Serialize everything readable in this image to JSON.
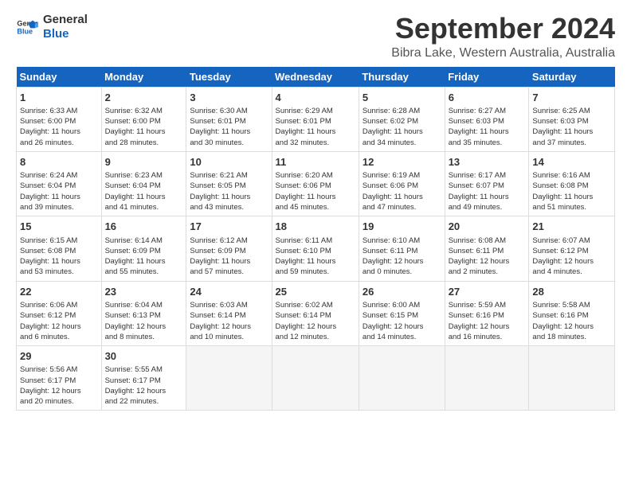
{
  "logo": {
    "line1": "General",
    "line2": "Blue"
  },
  "title": "September 2024",
  "subtitle": "Bibra Lake, Western Australia, Australia",
  "weekdays": [
    "Sunday",
    "Monday",
    "Tuesday",
    "Wednesday",
    "Thursday",
    "Friday",
    "Saturday"
  ],
  "weeks": [
    [
      {
        "day": "1",
        "lines": [
          "Sunrise: 6:33 AM",
          "Sunset: 6:00 PM",
          "Daylight: 11 hours",
          "and 26 minutes."
        ]
      },
      {
        "day": "2",
        "lines": [
          "Sunrise: 6:32 AM",
          "Sunset: 6:00 PM",
          "Daylight: 11 hours",
          "and 28 minutes."
        ]
      },
      {
        "day": "3",
        "lines": [
          "Sunrise: 6:30 AM",
          "Sunset: 6:01 PM",
          "Daylight: 11 hours",
          "and 30 minutes."
        ]
      },
      {
        "day": "4",
        "lines": [
          "Sunrise: 6:29 AM",
          "Sunset: 6:01 PM",
          "Daylight: 11 hours",
          "and 32 minutes."
        ]
      },
      {
        "day": "5",
        "lines": [
          "Sunrise: 6:28 AM",
          "Sunset: 6:02 PM",
          "Daylight: 11 hours",
          "and 34 minutes."
        ]
      },
      {
        "day": "6",
        "lines": [
          "Sunrise: 6:27 AM",
          "Sunset: 6:03 PM",
          "Daylight: 11 hours",
          "and 35 minutes."
        ]
      },
      {
        "day": "7",
        "lines": [
          "Sunrise: 6:25 AM",
          "Sunset: 6:03 PM",
          "Daylight: 11 hours",
          "and 37 minutes."
        ]
      }
    ],
    [
      {
        "day": "8",
        "lines": [
          "Sunrise: 6:24 AM",
          "Sunset: 6:04 PM",
          "Daylight: 11 hours",
          "and 39 minutes."
        ]
      },
      {
        "day": "9",
        "lines": [
          "Sunrise: 6:23 AM",
          "Sunset: 6:04 PM",
          "Daylight: 11 hours",
          "and 41 minutes."
        ]
      },
      {
        "day": "10",
        "lines": [
          "Sunrise: 6:21 AM",
          "Sunset: 6:05 PM",
          "Daylight: 11 hours",
          "and 43 minutes."
        ]
      },
      {
        "day": "11",
        "lines": [
          "Sunrise: 6:20 AM",
          "Sunset: 6:06 PM",
          "Daylight: 11 hours",
          "and 45 minutes."
        ]
      },
      {
        "day": "12",
        "lines": [
          "Sunrise: 6:19 AM",
          "Sunset: 6:06 PM",
          "Daylight: 11 hours",
          "and 47 minutes."
        ]
      },
      {
        "day": "13",
        "lines": [
          "Sunrise: 6:17 AM",
          "Sunset: 6:07 PM",
          "Daylight: 11 hours",
          "and 49 minutes."
        ]
      },
      {
        "day": "14",
        "lines": [
          "Sunrise: 6:16 AM",
          "Sunset: 6:08 PM",
          "Daylight: 11 hours",
          "and 51 minutes."
        ]
      }
    ],
    [
      {
        "day": "15",
        "lines": [
          "Sunrise: 6:15 AM",
          "Sunset: 6:08 PM",
          "Daylight: 11 hours",
          "and 53 minutes."
        ]
      },
      {
        "day": "16",
        "lines": [
          "Sunrise: 6:14 AM",
          "Sunset: 6:09 PM",
          "Daylight: 11 hours",
          "and 55 minutes."
        ]
      },
      {
        "day": "17",
        "lines": [
          "Sunrise: 6:12 AM",
          "Sunset: 6:09 PM",
          "Daylight: 11 hours",
          "and 57 minutes."
        ]
      },
      {
        "day": "18",
        "lines": [
          "Sunrise: 6:11 AM",
          "Sunset: 6:10 PM",
          "Daylight: 11 hours",
          "and 59 minutes."
        ]
      },
      {
        "day": "19",
        "lines": [
          "Sunrise: 6:10 AM",
          "Sunset: 6:11 PM",
          "Daylight: 12 hours",
          "and 0 minutes."
        ]
      },
      {
        "day": "20",
        "lines": [
          "Sunrise: 6:08 AM",
          "Sunset: 6:11 PM",
          "Daylight: 12 hours",
          "and 2 minutes."
        ]
      },
      {
        "day": "21",
        "lines": [
          "Sunrise: 6:07 AM",
          "Sunset: 6:12 PM",
          "Daylight: 12 hours",
          "and 4 minutes."
        ]
      }
    ],
    [
      {
        "day": "22",
        "lines": [
          "Sunrise: 6:06 AM",
          "Sunset: 6:12 PM",
          "Daylight: 12 hours",
          "and 6 minutes."
        ]
      },
      {
        "day": "23",
        "lines": [
          "Sunrise: 6:04 AM",
          "Sunset: 6:13 PM",
          "Daylight: 12 hours",
          "and 8 minutes."
        ]
      },
      {
        "day": "24",
        "lines": [
          "Sunrise: 6:03 AM",
          "Sunset: 6:14 PM",
          "Daylight: 12 hours",
          "and 10 minutes."
        ]
      },
      {
        "day": "25",
        "lines": [
          "Sunrise: 6:02 AM",
          "Sunset: 6:14 PM",
          "Daylight: 12 hours",
          "and 12 minutes."
        ]
      },
      {
        "day": "26",
        "lines": [
          "Sunrise: 6:00 AM",
          "Sunset: 6:15 PM",
          "Daylight: 12 hours",
          "and 14 minutes."
        ]
      },
      {
        "day": "27",
        "lines": [
          "Sunrise: 5:59 AM",
          "Sunset: 6:16 PM",
          "Daylight: 12 hours",
          "and 16 minutes."
        ]
      },
      {
        "day": "28",
        "lines": [
          "Sunrise: 5:58 AM",
          "Sunset: 6:16 PM",
          "Daylight: 12 hours",
          "and 18 minutes."
        ]
      }
    ],
    [
      {
        "day": "29",
        "lines": [
          "Sunrise: 5:56 AM",
          "Sunset: 6:17 PM",
          "Daylight: 12 hours",
          "and 20 minutes."
        ]
      },
      {
        "day": "30",
        "lines": [
          "Sunrise: 5:55 AM",
          "Sunset: 6:17 PM",
          "Daylight: 12 hours",
          "and 22 minutes."
        ]
      },
      null,
      null,
      null,
      null,
      null
    ]
  ]
}
